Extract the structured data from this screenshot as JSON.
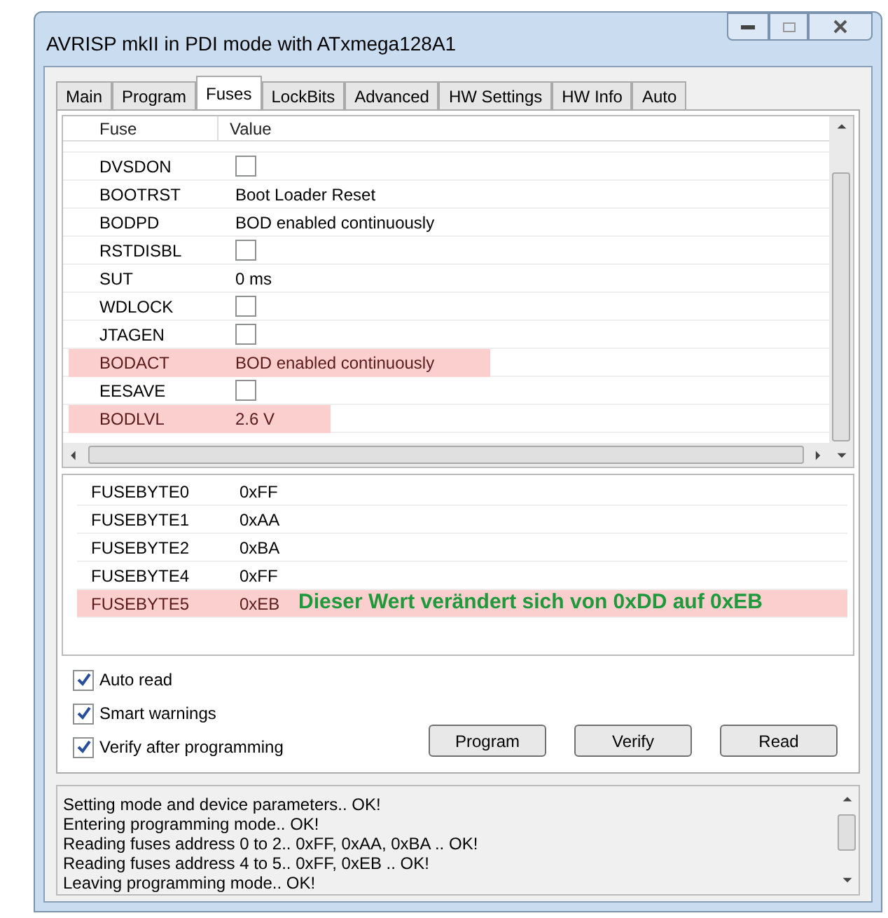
{
  "window": {
    "title": "AVRISP mkII in PDI mode with ATxmega128A1"
  },
  "tabs": [
    {
      "label": "Main",
      "selected": false
    },
    {
      "label": "Program",
      "selected": false
    },
    {
      "label": "Fuses",
      "selected": true
    },
    {
      "label": "LockBits",
      "selected": false
    },
    {
      "label": "Advanced",
      "selected": false
    },
    {
      "label": "HW Settings",
      "selected": false
    },
    {
      "label": "HW Info",
      "selected": false
    },
    {
      "label": "Auto",
      "selected": false
    }
  ],
  "fuse_table": {
    "columns": [
      "Fuse",
      "Value"
    ],
    "rows": [
      {
        "fuse": "DVSDON",
        "kind": "checkbox",
        "checked": false,
        "highlighted": false
      },
      {
        "fuse": "BOOTRST",
        "kind": "text",
        "value": "Boot Loader Reset",
        "highlighted": false
      },
      {
        "fuse": "BODPD",
        "kind": "text",
        "value": "BOD enabled continuously",
        "highlighted": false
      },
      {
        "fuse": "RSTDISBL",
        "kind": "checkbox",
        "checked": false,
        "highlighted": false
      },
      {
        "fuse": "SUT",
        "kind": "text",
        "value": "0 ms",
        "highlighted": false
      },
      {
        "fuse": "WDLOCK",
        "kind": "checkbox",
        "checked": false,
        "highlighted": false
      },
      {
        "fuse": "JTAGEN",
        "kind": "checkbox",
        "checked": false,
        "highlighted": false
      },
      {
        "fuse": "BODACT",
        "kind": "text",
        "value": "BOD enabled continuously",
        "highlighted": true
      },
      {
        "fuse": "EESAVE",
        "kind": "checkbox",
        "checked": false,
        "highlighted": false
      },
      {
        "fuse": "BODLVL",
        "kind": "text",
        "value": "2.6 V",
        "highlighted": true
      }
    ]
  },
  "fuse_bytes": [
    {
      "name": "FUSEBYTE0",
      "value": "0xFF",
      "highlighted": false
    },
    {
      "name": "FUSEBYTE1",
      "value": "0xAA",
      "highlighted": false
    },
    {
      "name": "FUSEBYTE2",
      "value": "0xBA",
      "highlighted": false
    },
    {
      "name": "FUSEBYTE4",
      "value": "0xFF",
      "highlighted": false
    },
    {
      "name": "FUSEBYTE5",
      "value": "0xEB",
      "highlighted": true,
      "note": "Dieser Wert verändert sich von 0xDD auf 0xEB"
    }
  ],
  "options": [
    {
      "label": "Auto read",
      "checked": true
    },
    {
      "label": "Smart warnings",
      "checked": true
    },
    {
      "label": "Verify after programming",
      "checked": true
    }
  ],
  "buttons": [
    "Program",
    "Verify",
    "Read"
  ],
  "log": [
    "Setting mode and device parameters.. OK!",
    "Entering programming mode.. OK!",
    "Reading fuses address 0 to 2.. 0xFF, 0xAA, 0xBA .. OK!",
    "Reading fuses address 4 to 5.. 0xFF, 0xEB .. OK!",
    "Leaving programming mode.. OK!"
  ]
}
